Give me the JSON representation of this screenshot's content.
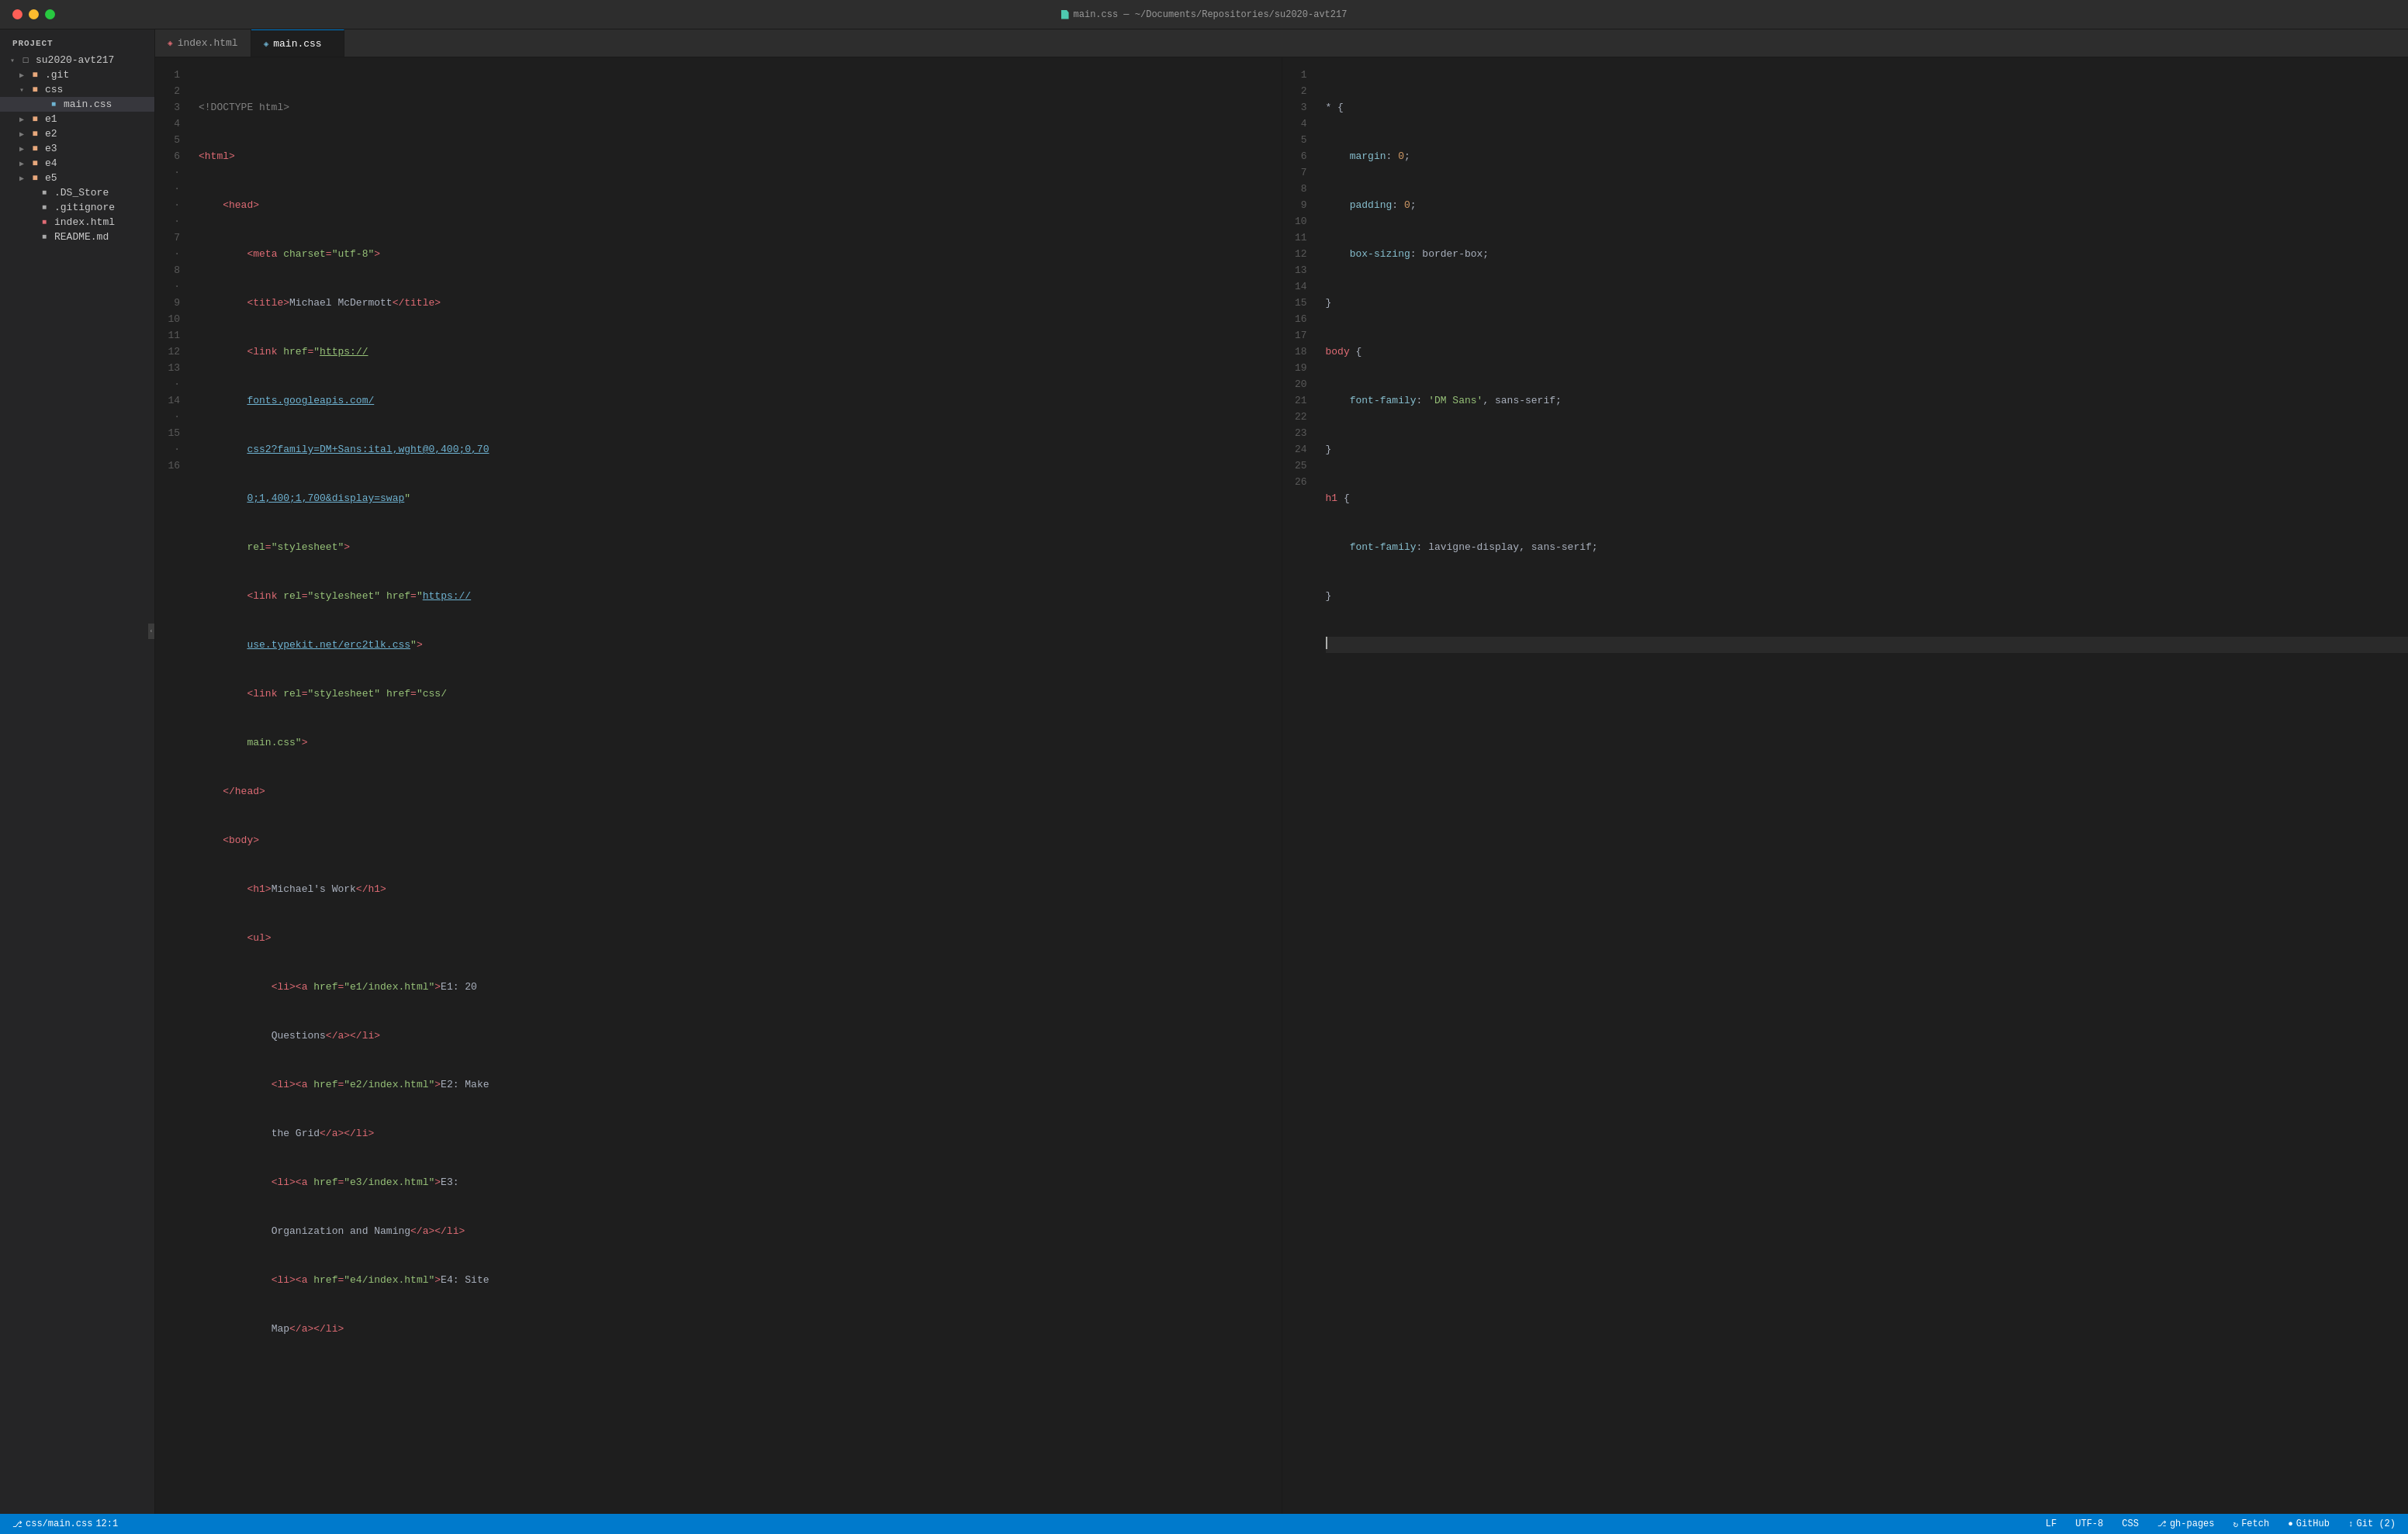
{
  "titlebar": {
    "title": "main.css — ~/Documents/Repositories/su2020-avt217",
    "buttons": {
      "red": "close",
      "yellow": "minimize",
      "green": "maximize"
    }
  },
  "sidebar": {
    "header": "Project",
    "tree": [
      {
        "id": "root",
        "label": "su2020-avt217",
        "type": "root-folder",
        "indent": 0,
        "expanded": true,
        "arrow": "▾"
      },
      {
        "id": "git",
        "label": ".git",
        "type": "folder",
        "indent": 1,
        "expanded": false,
        "arrow": "▶"
      },
      {
        "id": "css",
        "label": "css",
        "type": "folder-open",
        "indent": 1,
        "expanded": true,
        "arrow": "▾"
      },
      {
        "id": "maincss",
        "label": "main.css",
        "type": "css",
        "indent": 2,
        "expanded": false,
        "arrow": ""
      },
      {
        "id": "e1",
        "label": "e1",
        "type": "folder",
        "indent": 1,
        "expanded": false,
        "arrow": "▶"
      },
      {
        "id": "e2",
        "label": "e2",
        "type": "folder",
        "indent": 1,
        "expanded": false,
        "arrow": "▶"
      },
      {
        "id": "e3",
        "label": "e3",
        "type": "folder",
        "indent": 1,
        "expanded": false,
        "arrow": "▶"
      },
      {
        "id": "e4",
        "label": "e4",
        "type": "folder",
        "indent": 1,
        "expanded": false,
        "arrow": "▶"
      },
      {
        "id": "e5",
        "label": "e5",
        "type": "folder",
        "indent": 1,
        "expanded": false,
        "arrow": "▶"
      },
      {
        "id": "dsstore",
        "label": ".DS_Store",
        "type": "ds",
        "indent": 1,
        "expanded": false,
        "arrow": ""
      },
      {
        "id": "gitignore",
        "label": ".gitignore",
        "type": "git",
        "indent": 1,
        "expanded": false,
        "arrow": ""
      },
      {
        "id": "indexhtml",
        "label": "index.html",
        "type": "html",
        "indent": 1,
        "expanded": false,
        "arrow": ""
      },
      {
        "id": "readmemd",
        "label": "README.md",
        "type": "md",
        "indent": 1,
        "expanded": false,
        "arrow": ""
      }
    ]
  },
  "tabs": {
    "left": {
      "label": "index.html",
      "type": "html",
      "active": false
    },
    "right": {
      "label": "main.css",
      "type": "css",
      "active": true
    }
  },
  "html_editor": {
    "lines": [
      {
        "num": 1,
        "content": "<!DOCTYPE html>"
      },
      {
        "num": 2,
        "content": "<html>"
      },
      {
        "num": 3,
        "content": "    <head>"
      },
      {
        "num": 4,
        "content": "        <meta charset=\"utf-8\">"
      },
      {
        "num": 5,
        "content": "        <title>Michael McDermott</title>"
      },
      {
        "num": 6,
        "content": "        <link href=\"https://"
      },
      {
        "num": 6,
        "content_cont": "        fonts.googleapis.com/"
      },
      {
        "num": 6,
        "content_cont2": "        css2?family=DM+Sans:ital,wght@0,400;0,70"
      },
      {
        "num": 6,
        "content_cont3": "        0;1,400;1,700&display=swap\""
      },
      {
        "num": 6,
        "content_cont4": "        rel=\"stylesheet\">"
      },
      {
        "num": 7,
        "content": "        <link rel=\"stylesheet\" href=\"https://"
      },
      {
        "num": 7,
        "content_cont": "        use.typekit.net/erc2tlk.css\">"
      },
      {
        "num": 8,
        "content": "        <link rel=\"stylesheet\" href=\"css/"
      },
      {
        "num": 8,
        "content_cont": "        main.css\">"
      },
      {
        "num": 9,
        "content": "    </head>"
      },
      {
        "num": 10,
        "content": "    <body>"
      },
      {
        "num": 11,
        "content": "        <h1>Michael's Work</h1>"
      },
      {
        "num": 12,
        "content": "        <ul>"
      },
      {
        "num": 13,
        "content": "            <li><a href=\"e1/index.html\">E1: 20 Questions</a></li>"
      },
      {
        "num": 14,
        "content": "            <li><a href=\"e2/index.html\">E2: Make the Grid</a></li>"
      },
      {
        "num": 15,
        "content": "            <li><a href=\"e3/index.html\">E3: Organization and Naming</a></li>"
      },
      {
        "num": 16,
        "content": "            <li><a href=\"e4/index.html\">E4: Site Map</a></li>"
      }
    ]
  },
  "css_editor": {
    "lines": [
      {
        "num": 1,
        "content": "* {"
      },
      {
        "num": 2,
        "content": "    margin: 0;"
      },
      {
        "num": 3,
        "content": "    padding: 0;"
      },
      {
        "num": 4,
        "content": "    box-sizing: border-box;"
      },
      {
        "num": 5,
        "content": "}"
      },
      {
        "num": 6,
        "content": "body {"
      },
      {
        "num": 7,
        "content": "    font-family: 'DM Sans', sans-serif;"
      },
      {
        "num": 8,
        "content": "}"
      },
      {
        "num": 9,
        "content": "h1 {"
      },
      {
        "num": 10,
        "content": "    font-family: lavigne-display, sans-serif;"
      },
      {
        "num": 11,
        "content": "}"
      },
      {
        "num": 12,
        "content": ""
      },
      {
        "num": 13,
        "content": ""
      },
      {
        "num": 14,
        "content": ""
      },
      {
        "num": 15,
        "content": ""
      },
      {
        "num": 16,
        "content": ""
      },
      {
        "num": 17,
        "content": ""
      },
      {
        "num": 18,
        "content": ""
      },
      {
        "num": 19,
        "content": ""
      },
      {
        "num": 20,
        "content": ""
      },
      {
        "num": 21,
        "content": ""
      },
      {
        "num": 22,
        "content": ""
      },
      {
        "num": 23,
        "content": ""
      },
      {
        "num": 24,
        "content": ""
      },
      {
        "num": 25,
        "content": ""
      },
      {
        "num": 26,
        "content": ""
      }
    ]
  },
  "statusbar": {
    "left": {
      "filepath": "css/main.css",
      "position": "12:1"
    },
    "right": {
      "eol": "LF",
      "encoding": "UTF-8",
      "language": "CSS",
      "branch": "gh-pages",
      "fetch": "Fetch",
      "github": "GitHub",
      "git": "Git (2)"
    }
  }
}
